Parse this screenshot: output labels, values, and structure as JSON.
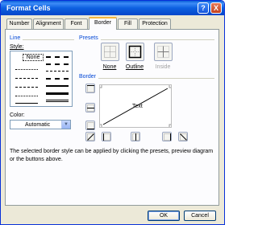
{
  "window": {
    "title": "Format Cells",
    "help_glyph": "?",
    "close_glyph": "X"
  },
  "tabs": [
    {
      "label": "Number"
    },
    {
      "label": "Alignment"
    },
    {
      "label": "Font"
    },
    {
      "label": "Border",
      "active": true
    },
    {
      "label": "Fill"
    },
    {
      "label": "Protection"
    }
  ],
  "line_group": {
    "title": "Line",
    "style_label": "Style:",
    "none_label": "None",
    "color_label": "Color:",
    "color_value": "Automatic"
  },
  "presets_group": {
    "title": "Presets",
    "items": [
      {
        "label": "None",
        "icon": "preset-none-icon"
      },
      {
        "label": "Outline",
        "icon": "preset-outline-icon"
      },
      {
        "label": "Inside",
        "icon": "preset-inside-icon"
      }
    ]
  },
  "border_group": {
    "title": "Border",
    "preview_text": "Text"
  },
  "info_text": "The selected border style can be applied by clicking the presets, preview diagram or the buttons above.",
  "footer": {
    "ok_label": "OK",
    "cancel_label": "Cancel"
  },
  "colors": {
    "title_bar": "#0a5fd8",
    "accent_tab": "#f5b73c",
    "group_title": "#0046d5",
    "dialog_bg": "#ece9d8"
  }
}
